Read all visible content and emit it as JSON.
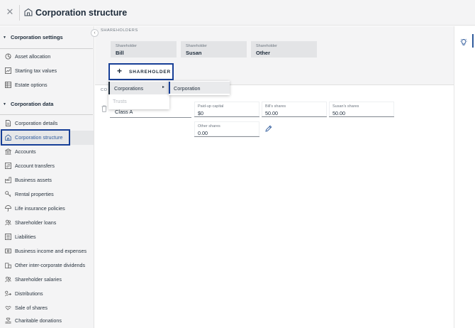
{
  "window": {
    "title": "Corporation structure",
    "close_icon": "close-icon",
    "title_icon": "building-icon"
  },
  "sidebar": {
    "sections": [
      {
        "title": "Corporation settings",
        "items": [
          {
            "label": "Asset allocation",
            "icon": "pie-icon"
          },
          {
            "label": "Starting tax values",
            "icon": "chart-icon"
          },
          {
            "label": "Estate options",
            "icon": "grid-icon"
          }
        ]
      },
      {
        "title": "Corporation data",
        "items": [
          {
            "label": "Corporation details",
            "icon": "document-icon"
          },
          {
            "label": "Corporation structure",
            "icon": "building-icon",
            "active": true
          },
          {
            "label": "Accounts",
            "icon": "bank-icon"
          },
          {
            "label": "Account transfers",
            "icon": "transfer-icon"
          },
          {
            "label": "Business assets",
            "icon": "factory-icon"
          },
          {
            "label": "Rental properties",
            "icon": "key-icon"
          },
          {
            "label": "Life insurance policies",
            "icon": "umbrella-icon"
          },
          {
            "label": "Shareholder loans",
            "icon": "people-icon"
          },
          {
            "label": "Liabilities",
            "icon": "ledger-icon"
          },
          {
            "label": "Business income and expenses",
            "icon": "cash-icon"
          },
          {
            "label": "Other inter-corporate dividends",
            "icon": "building-icon"
          },
          {
            "label": "Shareholder salaries",
            "icon": "people-icon"
          },
          {
            "label": "Distributions",
            "icon": "share-icon"
          },
          {
            "label": "Sale of shares",
            "icon": "handshake-icon"
          },
          {
            "label": "Charitable donations",
            "icon": "heart-hand-icon"
          }
        ]
      }
    ]
  },
  "main": {
    "shareholders_heading": "SHAREHOLDERS",
    "shareholders": [
      {
        "label": "Shareholder",
        "name": "Bill"
      },
      {
        "label": "Shareholder",
        "name": "Susan"
      },
      {
        "label": "Shareholder",
        "name": "Other"
      }
    ],
    "add_shareholder_label": "SHAREHOLDER",
    "classes_heading": "CO",
    "share_class": {
      "name": "Class A",
      "fields": [
        {
          "label": "Paid-up capital",
          "value": "$0"
        },
        {
          "label": "Bill's shares",
          "value": "50.00"
        },
        {
          "label": "Susan's shares",
          "value": "50.00"
        },
        {
          "label": "Other shares",
          "value": "0.00"
        }
      ]
    }
  },
  "dropdown": {
    "items": [
      {
        "label": "Corporations",
        "has_submenu": true
      },
      {
        "label": "Trusts",
        "disabled": true
      }
    ],
    "submenu": [
      {
        "label": "Corporation"
      }
    ]
  },
  "colors": {
    "accent": "#173f97",
    "active_text": "#2e5a9b",
    "sidebar_bg": "#f4f4f5"
  }
}
